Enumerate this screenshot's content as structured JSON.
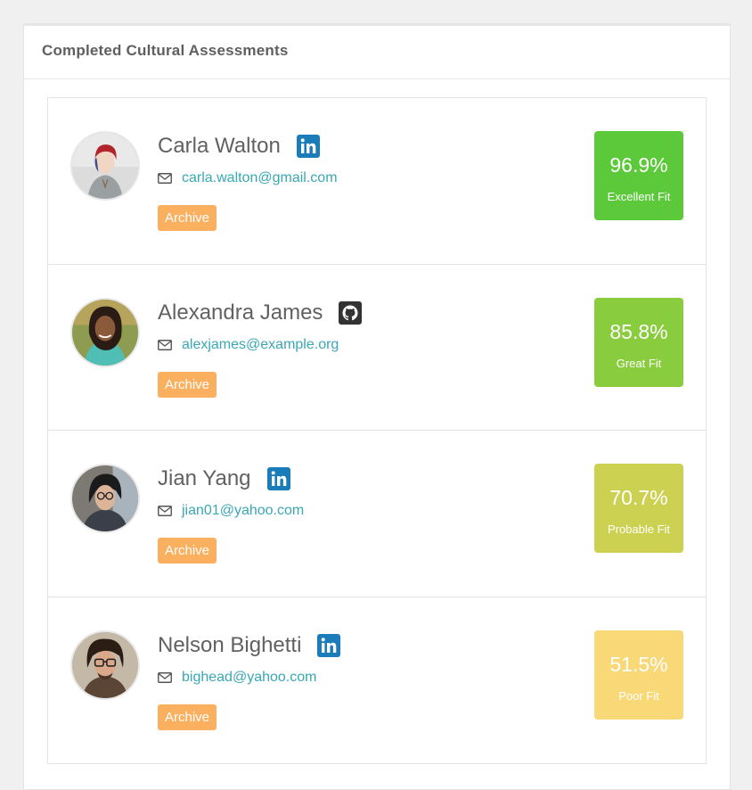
{
  "panel": {
    "title": "Completed Cultural Assessments"
  },
  "candidates": [
    {
      "name": "Carla Walton",
      "email": "carla.walton@gmail.com",
      "social_icon": "linkedin-icon",
      "archive_label": "Archive",
      "score": "96.9%",
      "fit_label": "Excellent Fit",
      "score_color": "#5cc93a"
    },
    {
      "name": "Alexandra James",
      "email": "alexjames@example.org",
      "social_icon": "github-icon",
      "archive_label": "Archive",
      "score": "85.8%",
      "fit_label": "Great Fit",
      "score_color": "#89cc3e"
    },
    {
      "name": "Jian Yang",
      "email": "jian01@yahoo.com",
      "social_icon": "linkedin-icon",
      "archive_label": "Archive",
      "score": "70.7%",
      "fit_label": "Probable Fit",
      "score_color": "#cdd152"
    },
    {
      "name": "Nelson Bighetti",
      "email": "bighead@yahoo.com",
      "social_icon": "linkedin-icon",
      "archive_label": "Archive",
      "score": "51.5%",
      "fit_label": "Poor Fit",
      "score_color": "#f9d877"
    }
  ],
  "colors": {
    "archive": "#fbb060",
    "link": "#3aa7b5",
    "linkedin": "#1a7cb8",
    "github": "#333333"
  }
}
